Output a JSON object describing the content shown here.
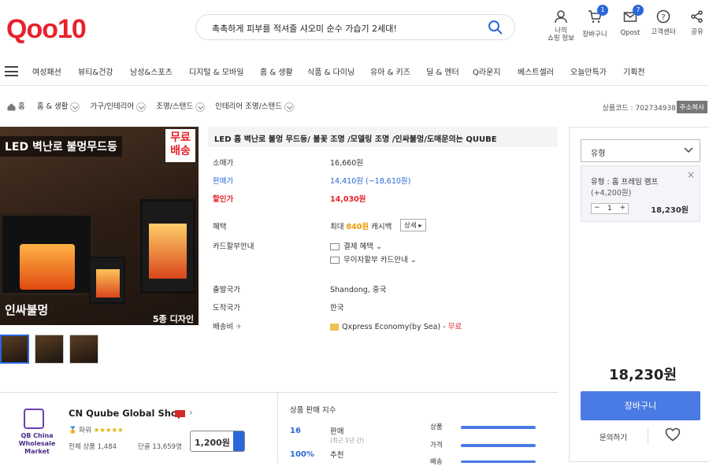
{
  "header": {
    "logo": "Qoo10",
    "search_text": "촉촉하게 피부를 적셔줄 샤오미 순수 가습기 2세대!",
    "my": "나의\n쇼핑 정보",
    "cart": "장바구니",
    "cart_count": "1",
    "qpost": "Qpost",
    "qpost_count": "7",
    "cs": "고객센터",
    "share": "공유"
  },
  "nav": [
    "여성패션",
    "뷰티&건강",
    "남성&스포츠",
    "디지털 & 모바일",
    "홈 & 생활",
    "식품 & 다이닝",
    "유아 & 키즈",
    "딜 & 엔터",
    "Q라운지",
    "베스트셀러",
    "오늘만특가",
    "기획전"
  ],
  "breadcrumb": [
    "홈",
    "홈 & 생활",
    "가구/인테리어",
    "조명/스탠드",
    "인테리어 조명/스탠드"
  ],
  "product_code_label": "상품코드 : 702734938",
  "address_copy": "주소복사",
  "image": {
    "banner": "LED 벽난로 불멍무드등",
    "free_ship": "무료\n배송",
    "corner_text": "인싸불멍",
    "variants": "5종 디자인"
  },
  "product": {
    "title": "LED 홈 벽난로 불멍 무드등/ 불꽃 조명 /모델링 조명 /인싸불멍/도매문의는 QUUBE",
    "retail_label": "소매가",
    "retail": "16,660원",
    "sale_label": "판매가",
    "sale": "14,410원",
    "sale_range": "(~18,610원)",
    "discount_label": "할인가",
    "discount": "14,030원",
    "benefit_label": "혜택",
    "benefit_prefix": "최대 ",
    "benefit_amount": "840원",
    "benefit_suffix": " 캐시백",
    "benefit_btn": "상세 ▸",
    "card_label": "카드할부안내",
    "card1": "결제 혜택",
    "card2": "무이자할부 카드안내",
    "origin_label": "출발국가",
    "origin": "Shandong, 중국",
    "dest_label": "도착국가",
    "dest": "한국",
    "ship_label": "배송비",
    "ship_method": "Qxpress Economy(by Sea) -",
    "ship_free": "무료"
  },
  "panel": {
    "select_label": "유형",
    "option_name": "유형 : 홈 프레임 램프",
    "option_extra": "(+4,200원)",
    "qty": "1",
    "option_price": "18,230원",
    "total": "18,230원",
    "cart_btn": "장바구니",
    "inquiry": "문의하기"
  },
  "seller": {
    "logo_text": "QB China\nWholesale Market",
    "name": "CN Quube Global Shop",
    "grade_label": "파워",
    "total_label": "전체 상품 1,484",
    "fans_label": "단골 13,659명",
    "coupon": "1,200원",
    "index_title": "상품 판매 지수",
    "stat1_value": "16",
    "stat1_label": "판매",
    "stat1_sub": "(최근 1년 간)",
    "stat2_value": "100%",
    "stat2_label": "추천",
    "bar1": "상품",
    "bar2": "가격",
    "bar3": "배송"
  },
  "colors": {
    "brand": "#e8222b",
    "blue": "#2a67d8",
    "button": "#4a7ae3"
  }
}
